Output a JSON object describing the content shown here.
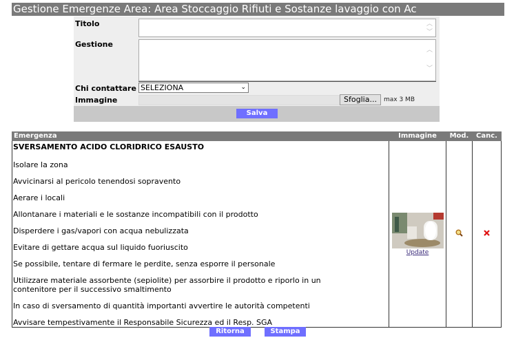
{
  "header": {
    "title": "Gestione Emergenze Area: Area Stoccaggio Rifiuti e Sostanze lavaggio con Ac"
  },
  "form": {
    "titolo_label": "Titolo",
    "titolo_value": "",
    "gestione_label": "Gestione",
    "gestione_value": "",
    "contact_label": "Chi contattare",
    "contact_selected": "SELEZIONA",
    "image_label": "Immagine",
    "browse_label": "Sfoglia...",
    "max_size": "max 3 MB",
    "save_label": "Salva"
  },
  "table": {
    "headers": {
      "emergenza": "Emergenza",
      "immagine": "Immagine",
      "mod": "Mod.",
      "canc": "Canc."
    },
    "rows": [
      {
        "title": "SVERSAMENTO ACIDO CLORIDRICO ESAUSTO",
        "items": [
          "Isolare la zona",
          "Avvicinarsi al pericolo tenendosi sopravento",
          "Aerare i locali",
          "Allontanare i materiali e le sostanze incompatibili con il prodotto",
          "Disperdere i gas/vapori con acqua nebulizzata",
          "Evitare di gettare acqua sul liquido fuoriuscito",
          "Se possibile, tentare di fermare le perdite, senza esporre il personale",
          "Utilizzare materiale assorbente (sepiolite) per assorbire il prodotto e riporlo in un contenitore per il successivo smaltimento",
          "In caso di sversamento di quantità importanti avvertire le autorità competenti",
          "Avvisare tempestivamente il Responsabile Sicurezza ed il Resp. SGA"
        ],
        "image_link": "Update",
        "edit_icon": "magnifier-icon",
        "delete_icon": "red-x-icon"
      }
    ]
  },
  "footer": {
    "back_label": "Ritorna",
    "print_label": "Stampa"
  },
  "colors": {
    "header_gray": "#7a7a7a",
    "button_blue": "#6f6fff",
    "delete_red": "#e01010"
  }
}
